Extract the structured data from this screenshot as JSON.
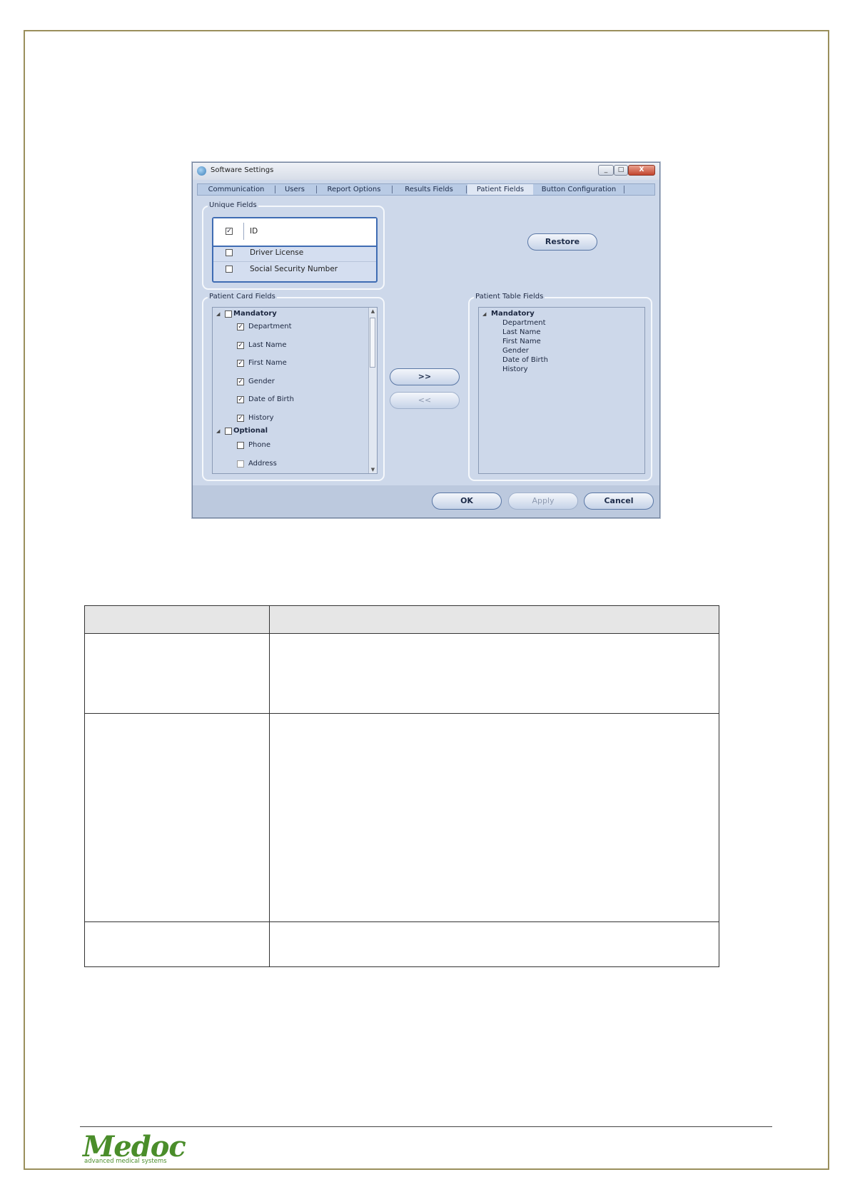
{
  "dialog": {
    "title": "Software Settings",
    "window_buttons": {
      "minimize": "_",
      "maximize": "□",
      "close": "X"
    },
    "tabs": [
      {
        "label": "Communication",
        "active": false
      },
      {
        "label": "Users",
        "active": false
      },
      {
        "label": "Report Options",
        "active": false
      },
      {
        "label": "Results Fields",
        "active": false
      },
      {
        "label": "Patient Fields",
        "active": true
      },
      {
        "label": "Button Configuration",
        "active": false
      }
    ],
    "unique_fields": {
      "label": "Unique Fields",
      "items": [
        {
          "label": "ID",
          "checked": true
        },
        {
          "label": "Driver License",
          "checked": false
        },
        {
          "label": "Social Security Number",
          "checked": false
        }
      ]
    },
    "restore_button": "Restore",
    "patient_card_fields": {
      "label": "Patient Card Fields",
      "mandatory_label": "Mandatory",
      "mandatory_items": [
        "Department",
        "Last Name",
        "First Name",
        "Gender",
        "Date of Birth",
        "History"
      ],
      "optional_label": "Optional",
      "optional_items": [
        "Phone",
        "Address"
      ]
    },
    "move_right_button": ">>",
    "move_left_button": "<<",
    "patient_table_fields": {
      "label": "Patient Table Fields",
      "mandatory_label": "Mandatory",
      "items": [
        "Department",
        "Last Name",
        "First Name",
        "Gender",
        "Date of Birth",
        "History"
      ]
    },
    "ok_button": "OK",
    "apply_button": "Apply",
    "cancel_button": "Cancel"
  },
  "footer": {
    "logo_text": "Medoc",
    "logo_tagline": "advanced medical systems"
  }
}
